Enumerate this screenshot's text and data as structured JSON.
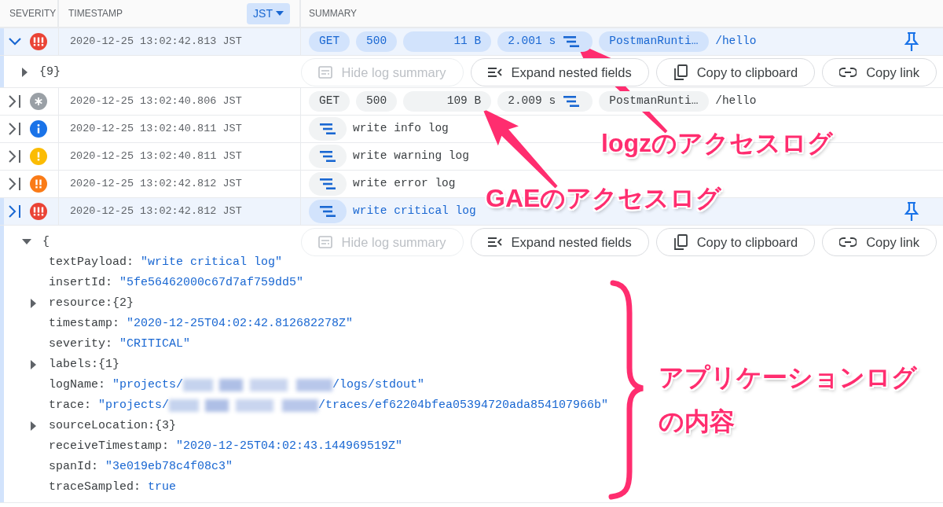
{
  "columns": [
    {
      "label": "SEVERITY"
    },
    {
      "label": "TIMESTAMP",
      "control": "JST"
    },
    {
      "label": "SUMMARY"
    }
  ],
  "entries": [
    {
      "kind": "critical",
      "expanded": true,
      "selected": true,
      "timestamp": "2020-12-25 13:02:42.813 JST",
      "chips": [
        {
          "kind": "method",
          "text": "GET"
        },
        {
          "kind": "status",
          "text": "500"
        },
        {
          "kind": "size",
          "text": "11 B"
        },
        {
          "kind": "latency",
          "text": "2.001 s"
        },
        {
          "kind": "agent",
          "text": "PostmanRunti…"
        }
      ],
      "path": "/hello",
      "pin": true,
      "detail": {
        "tree": {
          "expanded": false,
          "label": "{9}"
        },
        "buttons": [
          {
            "label": "Hide log summary",
            "disabled": true
          },
          {
            "label": "Expand nested fields",
            "disabled": false
          },
          {
            "label": "Copy to clipboard",
            "disabled": false
          },
          {
            "label": "Copy link",
            "disabled": false
          }
        ]
      }
    },
    {
      "kind": "default",
      "expanded": false,
      "selected": false,
      "timestamp": "2020-12-25 13:02:40.806 JST",
      "chips": [
        {
          "kind": "method",
          "text": "GET"
        },
        {
          "kind": "status",
          "text": "500"
        },
        {
          "kind": "size",
          "text": "109 B"
        },
        {
          "kind": "latency",
          "text": "2.009 s"
        },
        {
          "kind": "agent",
          "text": "PostmanRunti…"
        }
      ],
      "path": "/hello",
      "pin": false
    },
    {
      "kind": "info",
      "expanded": false,
      "selected": false,
      "timestamp": "2020-12-25 13:02:40.811 JST",
      "trace": true,
      "message": "write info log",
      "pin": false
    },
    {
      "kind": "warning",
      "expanded": false,
      "selected": false,
      "timestamp": "2020-12-25 13:02:40.811 JST",
      "trace": true,
      "message": "write warning log",
      "pin": false
    },
    {
      "kind": "error",
      "expanded": false,
      "selected": false,
      "timestamp": "2020-12-25 13:02:42.812 JST",
      "trace": true,
      "message": "write error log",
      "pin": false
    },
    {
      "kind": "critical",
      "expanded": false,
      "selected": true,
      "timestamp": "2020-12-25 13:02:42.812 JST",
      "trace": true,
      "message": "write critical log",
      "pin": true,
      "detail": {
        "tree": {
          "expanded": true,
          "label": "{",
          "fields": [
            {
              "key": "textPayload:",
              "kind": "string",
              "value": "\"write critical log\""
            },
            {
              "key": "insertId:",
              "kind": "string",
              "value": "\"5fe56462000c67d7af759dd5\""
            },
            {
              "key": "resource:",
              "kind": "object",
              "value": "{2}"
            },
            {
              "key": "timestamp:",
              "kind": "string",
              "value": "\"2020-12-25T04:02:42.812682278Z\""
            },
            {
              "key": "severity:",
              "kind": "string",
              "value": "\"CRITICAL\""
            },
            {
              "key": "labels:",
              "kind": "object",
              "value": "{1}"
            },
            {
              "key": "logName:",
              "kind": "string",
              "value": "\"projects/",
              "redacted": true,
              "value_after": "/logs/stdout\""
            },
            {
              "key": "trace:",
              "kind": "string",
              "value": "\"projects/",
              "redacted": true,
              "value_after": "/traces/ef62204bfea05394720ada854107966b\""
            },
            {
              "key": "sourceLocation:",
              "kind": "object",
              "value": "{3}"
            },
            {
              "key": "receiveTimestamp:",
              "kind": "string",
              "value": "\"2020-12-25T04:02:43.144969519Z\""
            },
            {
              "key": "spanId:",
              "kind": "string",
              "value": "\"3e019eb78c4f08c3\""
            },
            {
              "key": "traceSampled:",
              "kind": "bool",
              "value": "true"
            }
          ]
        },
        "buttons": [
          {
            "label": "Hide log summary",
            "disabled": true
          },
          {
            "label": "Expand nested fields",
            "disabled": false
          },
          {
            "label": "Copy to clipboard",
            "disabled": false
          },
          {
            "label": "Copy link",
            "disabled": false
          }
        ]
      }
    }
  ],
  "annotations": [
    {
      "kind": "arrow",
      "text": "logzのアクセスログ"
    },
    {
      "kind": "arrow",
      "text": "GAEのアクセスログ"
    },
    {
      "kind": "brace",
      "text": "アプリケーションログの内容"
    }
  ]
}
